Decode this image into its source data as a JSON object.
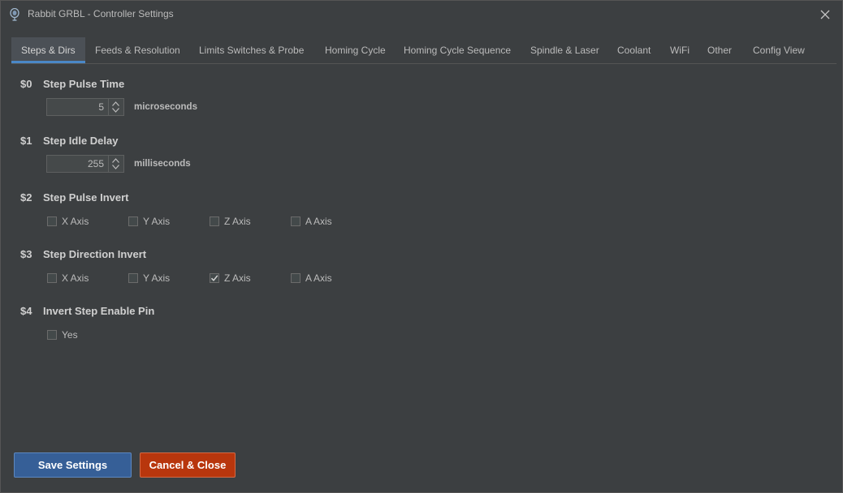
{
  "window": {
    "title": "Rabbit GRBL - Controller Settings"
  },
  "tabs": [
    {
      "label": "Steps & Dirs",
      "active": true
    },
    {
      "label": "Feeds & Resolution"
    },
    {
      "label": "Limits Switches & Probe"
    },
    {
      "label": "Homing Cycle"
    },
    {
      "label": "Homing Cycle Sequence"
    },
    {
      "label": "Spindle & Laser"
    },
    {
      "label": "Coolant"
    },
    {
      "label": "WiFi"
    },
    {
      "label": "Other"
    },
    {
      "label": "Config View"
    }
  ],
  "settings": {
    "s0": {
      "code": "$0",
      "title": "Step Pulse Time",
      "value": "5",
      "unit": "microseconds"
    },
    "s1": {
      "code": "$1",
      "title": "Step Idle Delay",
      "value": "255",
      "unit": "milliseconds"
    },
    "s2": {
      "code": "$2",
      "title": "Step Pulse Invert",
      "axes": [
        {
          "label": "X Axis",
          "checked": false
        },
        {
          "label": "Y Axis",
          "checked": false
        },
        {
          "label": "Z Axis",
          "checked": false
        },
        {
          "label": "A Axis",
          "checked": false
        }
      ]
    },
    "s3": {
      "code": "$3",
      "title": "Step Direction Invert",
      "axes": [
        {
          "label": "X Axis",
          "checked": false
        },
        {
          "label": "Y Axis",
          "checked": false
        },
        {
          "label": "Z Axis",
          "checked": true
        },
        {
          "label": "A Axis",
          "checked": false
        }
      ]
    },
    "s4": {
      "code": "$4",
      "title": "Invert Step Enable Pin",
      "option": {
        "label": "Yes",
        "checked": false
      }
    }
  },
  "buttons": {
    "save": "Save Settings",
    "cancel": "Cancel & Close"
  },
  "colors": {
    "background": "#3c3f41",
    "accent": "#4a88c7",
    "save": "#365f97",
    "cancel": "#b8360d"
  },
  "icons": {
    "app": "rabbit-logo-icon",
    "close": "close-icon",
    "spin_up": "chevron-up-icon",
    "spin_down": "chevron-down-icon",
    "check": "checkmark-icon"
  }
}
